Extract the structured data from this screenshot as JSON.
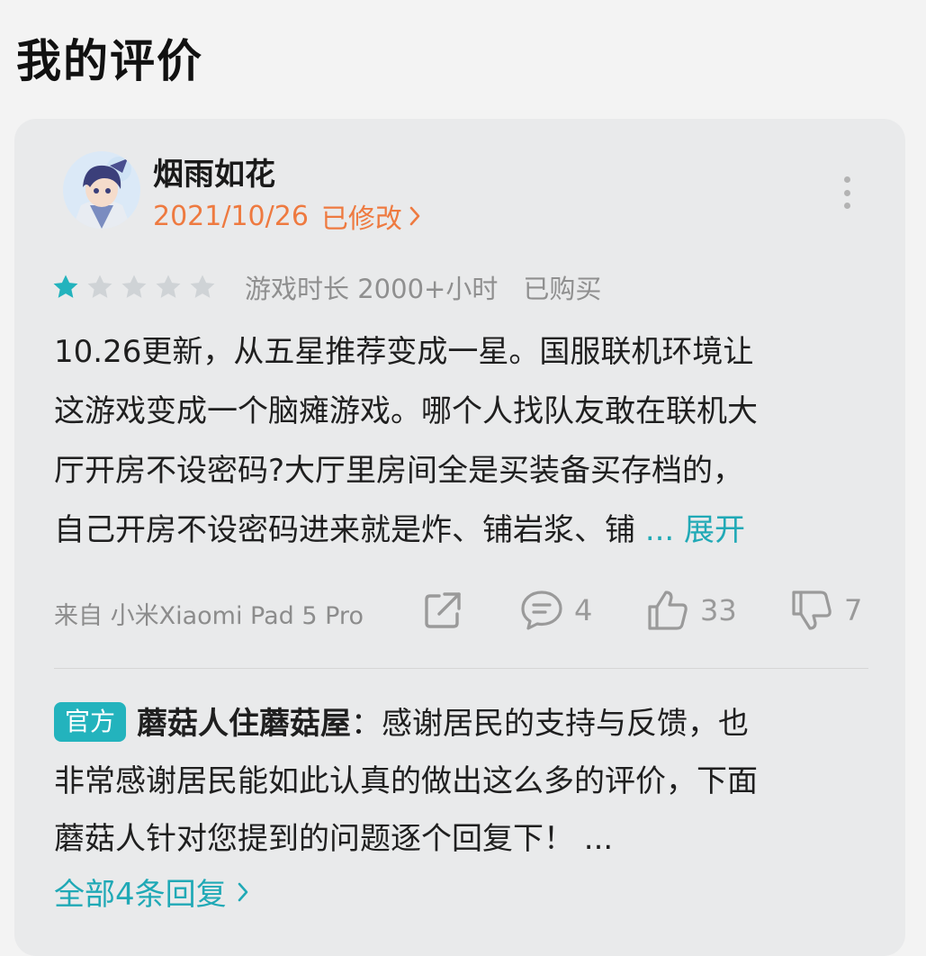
{
  "page": {
    "title": "我的评价"
  },
  "review": {
    "username": "烟雨如花",
    "date": "2021/10/26",
    "modified_label": "已修改",
    "rating": 1,
    "max_rating": 5,
    "play_time": "游戏时长 2000+小时",
    "purchase_status": "已购买",
    "body_lines": [
      "10.26更新，从五星推荐变成一星。国服联机环境让",
      "这游戏变成一个脑瘫游戏。哪个人找队友敢在联机大",
      "厅开房不设密码?大厅里房间全是买装备买存档的，",
      "自己开房不设密码进来就是炸、铺岩浆、铺 "
    ],
    "expand_label": "... 展开",
    "source": "来自 小米Xiaomi Pad 5 Pro",
    "comment_count": "4",
    "like_count": "33",
    "dislike_count": "7"
  },
  "reply": {
    "badge": "官方",
    "author": "蘑菇人住蘑菇屋",
    "separator": "：",
    "lines": [
      "感谢居民的支持与反馈，也",
      "非常感谢居民能如此认真的做出这么多的评价，下面",
      "蘑菇人针对您提到的问题逐个回复下！ ..."
    ],
    "all_replies_label": "全部4条回复"
  },
  "colors": {
    "accent": "#20a9b6",
    "date_orange": "#ee7a40",
    "star_filled": "#23b3bd",
    "star_empty": "#cfd3d6",
    "card_bg": "#e9eaeb"
  },
  "icons": [
    "more-vertical-icon",
    "share-icon",
    "comment-icon",
    "thumbs-up-icon",
    "thumbs-down-icon",
    "chevron-right-icon",
    "star-icon"
  ]
}
